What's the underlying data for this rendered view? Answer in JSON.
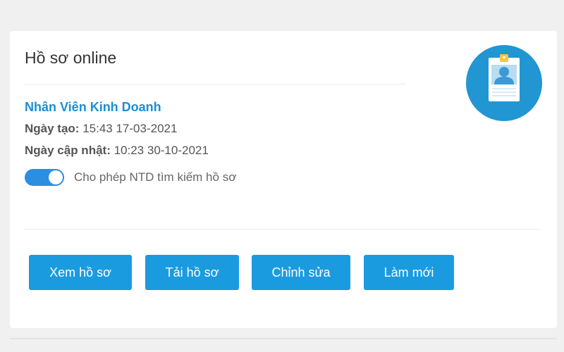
{
  "card": {
    "title": "Hồ sơ online",
    "job_title": "Nhân Viên Kinh Doanh",
    "created": {
      "label": "Ngày tạo:",
      "value": "15:43 17-03-2021"
    },
    "updated": {
      "label": "Ngày cập nhật:",
      "value": "10:23 30-10-2021"
    },
    "toggle": {
      "label": "Cho phép NTD tìm kiếm hồ sơ",
      "state": "on"
    },
    "buttons": {
      "view": "Xem hồ sơ",
      "download": "Tải hồ sơ",
      "edit": "Chỉnh sửa",
      "refresh": "Làm mới"
    },
    "avatar_icon": "id-badge-icon"
  },
  "colors": {
    "accent": "#1a9be0",
    "link": "#1a8fd3",
    "toggle_on": "#2b8ee0",
    "avatar_bg": "#2196d3",
    "badge_clip": "#f5c542"
  }
}
